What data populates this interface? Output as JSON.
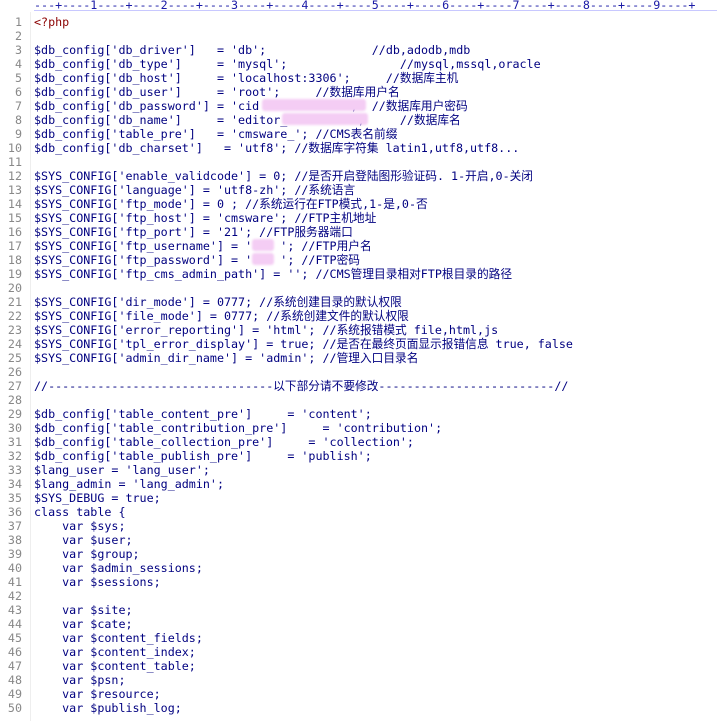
{
  "ruler": "---+----1----+----2----+----3----+----4----+----5----+----6----+----7----+----8----+----9----+",
  "lines": [
    {
      "n": "1",
      "t": "<?php"
    },
    {
      "n": "2",
      "t": ""
    },
    {
      "n": "3",
      "t": "$db_config['db_driver']   = 'db';               //db,adodb,mdb"
    },
    {
      "n": "4",
      "t": "$db_config['db_type']     = 'mysql';                //mysql,mssql,oracle"
    },
    {
      "n": "5",
      "t": "$db_config['db_host']     = 'localhost:3306';     //数据库主机"
    },
    {
      "n": "6",
      "t": "$db_config['db_user']     = 'root';     //数据库用户名"
    },
    {
      "n": "7",
      "t": "$db_config['db_password'] = 'cid            ';  //数据库用户密码"
    },
    {
      "n": "8",
      "t": "$db_config['db_name']     = 'editor_         ';     //数据库名"
    },
    {
      "n": "9",
      "t": "$db_config['table_pre']   = 'cmsware_'; //CMS表名前缀"
    },
    {
      "n": "10",
      "t": "$db_config['db_charset']   = 'utf8'; //数据库字符集 latin1,utf8,utf8..."
    },
    {
      "n": "11",
      "t": ""
    },
    {
      "n": "12",
      "t": "$SYS_CONFIG['enable_validcode'] = 0; //是否开启登陆图形验证码. 1-开启,0-关闭"
    },
    {
      "n": "13",
      "t": "$SYS_CONFIG['language'] = 'utf8-zh'; //系统语言"
    },
    {
      "n": "14",
      "t": "$SYS_CONFIG['ftp_mode'] = 0 ; //系统运行在FTP模式,1-是,0-否"
    },
    {
      "n": "15",
      "t": "$SYS_CONFIG['ftp_host'] = 'cmsware'; //FTP主机地址"
    },
    {
      "n": "16",
      "t": "$SYS_CONFIG['ftp_port'] = '21'; //FTP服务器端口"
    },
    {
      "n": "17",
      "t": "$SYS_CONFIG['ftp_username'] = '    '; //FTP用户名"
    },
    {
      "n": "18",
      "t": "$SYS_CONFIG['ftp_password'] = '    '; //FTP密码"
    },
    {
      "n": "19",
      "t": "$SYS_CONFIG['ftp_cms_admin_path'] = ''; //CMS管理目录相对FTP根目录的路径"
    },
    {
      "n": "20",
      "t": ""
    },
    {
      "n": "21",
      "t": "$SYS_CONFIG['dir_mode'] = 0777; //系统创建目录的默认权限"
    },
    {
      "n": "22",
      "t": "$SYS_CONFIG['file_mode'] = 0777; //系统创建文件的默认权限"
    },
    {
      "n": "23",
      "t": "$SYS_CONFIG['error_reporting'] = 'html'; //系统报错模式 file,html,js"
    },
    {
      "n": "24",
      "t": "$SYS_CONFIG['tpl_error_display'] = true; //是否在最终页面显示报错信息 true, false"
    },
    {
      "n": "25",
      "t": "$SYS_CONFIG['admin_dir_name'] = 'admin'; //管理入口目录名"
    },
    {
      "n": "26",
      "t": ""
    },
    {
      "n": "27",
      "t": "//--------------------------------以下部分请不要修改-------------------------//"
    },
    {
      "n": "28",
      "t": ""
    },
    {
      "n": "29",
      "t": "$db_config['table_content_pre']     = 'content';"
    },
    {
      "n": "30",
      "t": "$db_config['table_contribution_pre']     = 'contribution';"
    },
    {
      "n": "31",
      "t": "$db_config['table_collection_pre']     = 'collection';"
    },
    {
      "n": "32",
      "t": "$db_config['table_publish_pre']     = 'publish';"
    },
    {
      "n": "33",
      "t": "$lang_user = 'lang_user';"
    },
    {
      "n": "34",
      "t": "$lang_admin = 'lang_admin';"
    },
    {
      "n": "35",
      "t": "$SYS_DEBUG = true;"
    },
    {
      "n": "36",
      "t": "class table {"
    },
    {
      "n": "37",
      "t": "    var $sys;"
    },
    {
      "n": "38",
      "t": "    var $user;"
    },
    {
      "n": "39",
      "t": "    var $group;"
    },
    {
      "n": "40",
      "t": "    var $admin_sessions;"
    },
    {
      "n": "41",
      "t": "    var $sessions;"
    },
    {
      "n": "42",
      "t": ""
    },
    {
      "n": "43",
      "t": "    var $site;"
    },
    {
      "n": "44",
      "t": "    var $cate;"
    },
    {
      "n": "45",
      "t": "    var $content_fields;"
    },
    {
      "n": "46",
      "t": "    var $content_index;"
    },
    {
      "n": "47",
      "t": "    var $content_table;"
    },
    {
      "n": "48",
      "t": "    var $psn;"
    },
    {
      "n": "49",
      "t": "    var $resource;"
    },
    {
      "n": "50",
      "t": "    var $publish_log;"
    }
  ]
}
